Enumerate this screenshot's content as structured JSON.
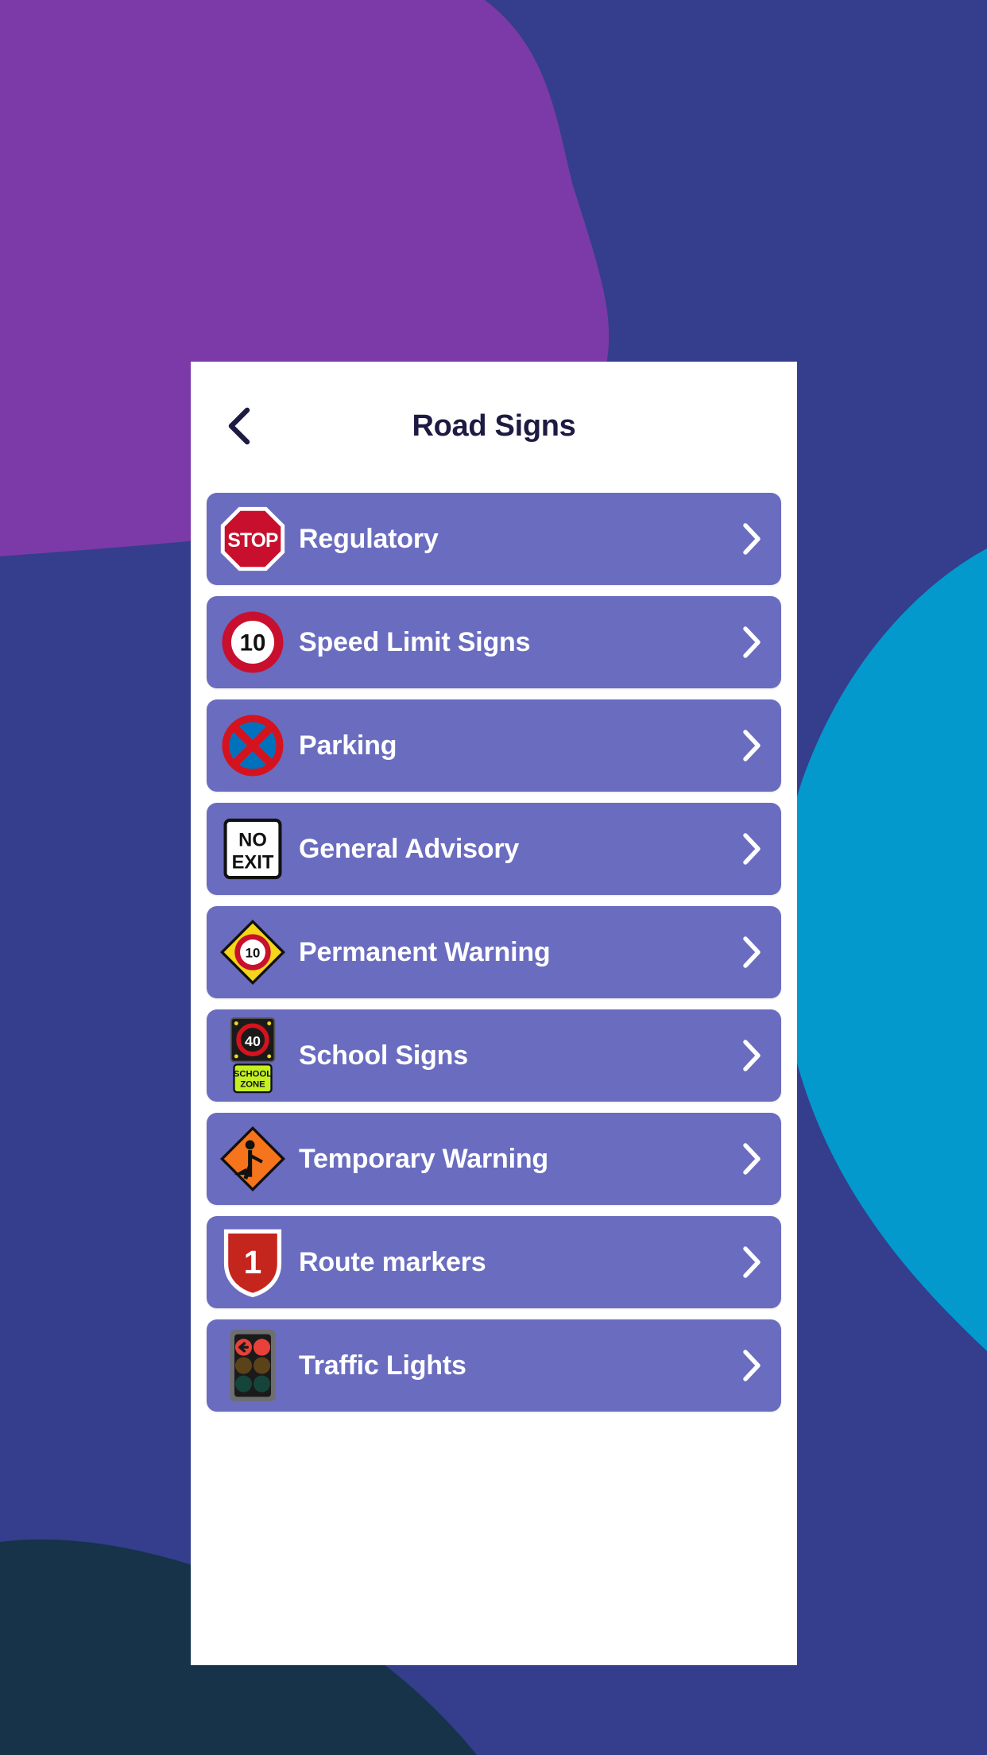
{
  "background": {
    "base_color": "#343E8C",
    "blobs": [
      {
        "name": "purple-blob",
        "color": "#7B3AA8",
        "position": "top-left"
      },
      {
        "name": "cyan-blob",
        "color": "#0399CC",
        "position": "right-middle"
      },
      {
        "name": "teal-blob",
        "color": "#16334A",
        "position": "bottom-left"
      }
    ]
  },
  "panel": {
    "background_color": "#FFFFFF"
  },
  "header": {
    "title": "Road Signs",
    "back_icon": "chevron-left-icon",
    "title_color": "#1D1B42"
  },
  "list": {
    "card_color": "#6A6CC0",
    "label_color": "#FFFFFF",
    "chevron_icon": "chevron-right-icon",
    "items": [
      {
        "label": "Regulatory",
        "icon": "stop-sign-icon",
        "sign_text": "STOP"
      },
      {
        "label": "Speed Limit Signs",
        "icon": "speed-limit-sign-icon",
        "sign_text": "10"
      },
      {
        "label": "Parking",
        "icon": "no-stopping-sign-icon",
        "sign_text": ""
      },
      {
        "label": "General Advisory",
        "icon": "no-exit-sign-icon",
        "sign_text": "NO EXIT"
      },
      {
        "label": "Permanent Warning",
        "icon": "warning-diamond-sign-icon",
        "sign_text": "10"
      },
      {
        "label": "School Signs",
        "icon": "school-zone-sign-icon",
        "sign_text": "40 SCHOOL ZONE"
      },
      {
        "label": "Temporary Warning",
        "icon": "roadworks-sign-icon",
        "sign_text": ""
      },
      {
        "label": "Route markers",
        "icon": "route-shield-icon",
        "sign_text": "1"
      },
      {
        "label": "Traffic Lights",
        "icon": "traffic-light-icon",
        "sign_text": ""
      }
    ]
  }
}
